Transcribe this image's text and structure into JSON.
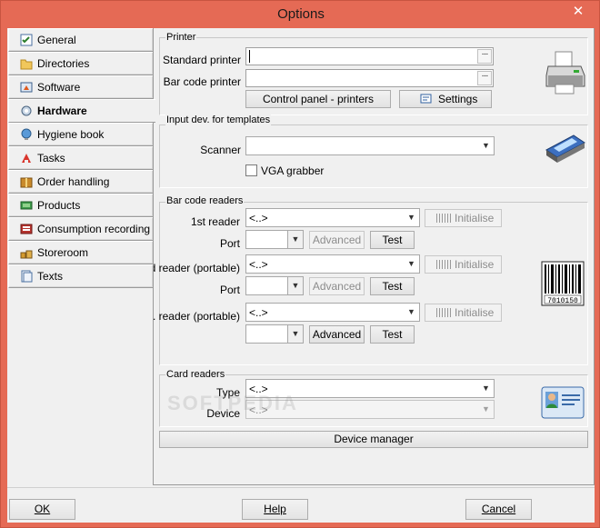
{
  "window": {
    "title": "Options",
    "close_glyph": "✕"
  },
  "tabs": [
    {
      "label": "General",
      "icon": "checklist-icon"
    },
    {
      "label": "Directories",
      "icon": "folder-icon"
    },
    {
      "label": "Software",
      "icon": "software-icon"
    },
    {
      "label": "Hardware",
      "icon": "hardware-icon",
      "active": true
    },
    {
      "label": "Hygiene book",
      "icon": "globe-icon"
    },
    {
      "label": "Tasks",
      "icon": "tasks-icon"
    },
    {
      "label": "Order handling",
      "icon": "package-icon"
    },
    {
      "label": "Products",
      "icon": "products-icon"
    },
    {
      "label": "Consumption recording",
      "icon": "consumption-icon"
    },
    {
      "label": "Storeroom",
      "icon": "storeroom-icon"
    },
    {
      "label": "Texts",
      "icon": "texts-icon"
    }
  ],
  "printer": {
    "group_label": "Printer",
    "standard_label": "Standard printer",
    "standard_value": "",
    "barcode_label": "Bar code printer",
    "barcode_value": "",
    "ellipsis": "···",
    "control_panel_label": "Control panel - printers",
    "settings_label": "Settings"
  },
  "input_dev": {
    "group_label": "Input dev. for templates",
    "scanner_label": "Scanner",
    "scanner_value": "",
    "vga_label": "VGA grabber"
  },
  "barcode_readers": {
    "group_label": "Bar code readers",
    "reader1_label": "1st reader",
    "reader2_label": "nd reader (portable)",
    "reader3_label": "d. reader (portable)",
    "port_label": "Port",
    "placeholder": "<..>",
    "advanced_label": "Advanced",
    "test_label": "Test",
    "initialise_label": "Initialise"
  },
  "card_readers": {
    "group_label": "Card readers",
    "type_label": "Type",
    "type_value": "<..>",
    "device_label": "Device",
    "device_value": "<..>"
  },
  "device_manager_label": "Device manager",
  "footer": {
    "ok_label": "OK",
    "help_label": "Help",
    "cancel_label": "Cancel"
  },
  "watermark": "SOFTPEDIA"
}
